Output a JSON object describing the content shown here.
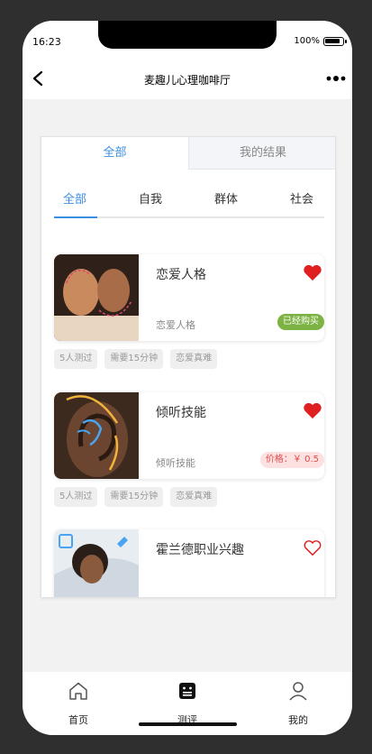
{
  "status": {
    "time": "16:23",
    "battery": "100%"
  },
  "nav": {
    "title": "麦趣儿心理咖啡厅"
  },
  "segments": {
    "all": "全部",
    "results": "我的结果"
  },
  "categories": [
    "全部",
    "自我",
    "群体",
    "社会"
  ],
  "items": [
    {
      "title": "恋爱人格",
      "subtitle": "恋爱人格",
      "badge": "已经购买",
      "badge_type": "bought",
      "favorited": true,
      "tags": [
        "5人测过",
        "需要15分钟",
        "恋爱真难"
      ]
    },
    {
      "title": "倾听技能",
      "subtitle": "倾听技能",
      "badge": "价格：￥ 0.5",
      "badge_type": "price",
      "favorited": true,
      "tags": [
        "5人测过",
        "需要15分钟",
        "恋爱真难"
      ]
    },
    {
      "title": "霍兰德职业兴趣",
      "favorited": false
    }
  ],
  "tabbar": {
    "home": "首页",
    "review": "测评",
    "mine": "我的"
  },
  "colors": {
    "accent": "#3b8fe0",
    "heart": "#e02020",
    "bought": "#7cb342",
    "price_bg": "#fde0e0"
  },
  "icons": {
    "back": "chevron-left-icon",
    "more": "more-dots-icon",
    "heart": "heart-icon",
    "home": "home-icon",
    "review": "clipboard-icon",
    "mine": "user-icon"
  }
}
